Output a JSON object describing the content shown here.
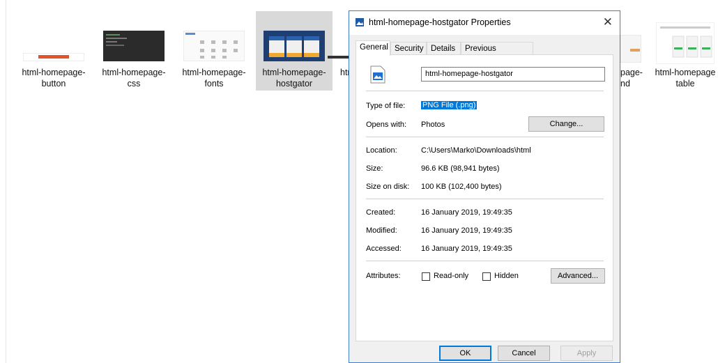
{
  "explorer": {
    "files": [
      {
        "name_line1": "html-homepage-",
        "name_line2": "button"
      },
      {
        "name_line1": "html-homepage-",
        "name_line2": "css"
      },
      {
        "name_line1": "html-homepage-",
        "name_line2": "fonts"
      },
      {
        "name_line1": "html-homepage-",
        "name_line2": "hostgator"
      },
      {
        "name_line1": "htm",
        "name_line2": ""
      },
      {
        "name_line1": "page-",
        "name_line2": "nd"
      },
      {
        "name_line1": "html-homepage",
        "name_line2": "table"
      }
    ]
  },
  "dialog": {
    "title": "html-homepage-hostgator Properties",
    "close_glyph": "✕",
    "tabs": [
      "General",
      "Security",
      "Details",
      "Previous Versions"
    ],
    "file_name": "html-homepage-hostgator",
    "type_label": "Type of file:",
    "type_value": "PNG File (.png)",
    "opens_label": "Opens with:",
    "opens_value": "Photos",
    "change_button": "Change...",
    "location_label": "Location:",
    "location_value": "C:\\Users\\Marko\\Downloads\\html",
    "size_label": "Size:",
    "size_value": "96.6 KB (98,941 bytes)",
    "size_disk_label": "Size on disk:",
    "size_disk_value": "100 KB (102,400 bytes)",
    "created_label": "Created:",
    "created_value": "16 January 2019, 19:49:35",
    "modified_label": "Modified:",
    "modified_value": "16 January 2019, 19:49:35",
    "accessed_label": "Accessed:",
    "accessed_value": "16 January 2019, 19:49:35",
    "attributes_label": "Attributes:",
    "readonly_label": "Read-only",
    "hidden_label": "Hidden",
    "advanced_button": "Advanced...",
    "ok_button": "OK",
    "cancel_button": "Cancel",
    "apply_button": "Apply"
  },
  "colors": {
    "accent": "#0078d7",
    "selection": "#d9d9d9"
  }
}
